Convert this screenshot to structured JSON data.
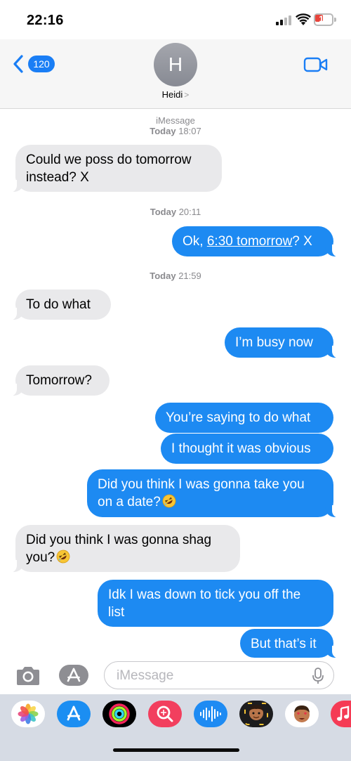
{
  "status_bar": {
    "time": "22:16",
    "battery_level": "10",
    "battery_color": "#e8453c"
  },
  "header": {
    "back_count": "120",
    "avatar_initial": "H",
    "contact_name": "Heidi",
    "contact_chevron": ">"
  },
  "conversation": {
    "service": "iMessage",
    "stamps": [
      {
        "day": "Today",
        "time": "18:07"
      },
      {
        "day": "Today",
        "time": "20:11"
      },
      {
        "day": "Today",
        "time": "21:59"
      }
    ],
    "messages": [
      {
        "direction": "received",
        "line1": "Could we poss do tomorrow",
        "line2": "instead? X"
      },
      {
        "direction": "sent",
        "prefix": "Ok, ",
        "link": "6:30 tomorrow",
        "suffix": "? X"
      },
      {
        "direction": "received",
        "text": "To do what"
      },
      {
        "direction": "sent",
        "text": "I’m busy now"
      },
      {
        "direction": "received",
        "text": "Tomorrow?"
      },
      {
        "direction": "sent",
        "text": "You’re saying to do what"
      },
      {
        "direction": "sent",
        "text": "I thought it was obvious"
      },
      {
        "direction": "sent",
        "line1": "Did you think I was gonna take you",
        "line2": "on a date?",
        "emoji": "rolling-on-floor-laughing"
      },
      {
        "direction": "received",
        "line1": "Did you think I was gonna shag",
        "line2": "you?",
        "emoji": "rolling-on-floor-laughing"
      },
      {
        "direction": "sent",
        "line1": "Idk I was down to tick you off the",
        "line2": "list"
      },
      {
        "direction": "sent",
        "text": "But that’s it"
      }
    ]
  },
  "composer": {
    "placeholder": "iMessage"
  },
  "app_drawer": {
    "apps": [
      "photos-app-icon",
      "app-store-icon",
      "activity-icon",
      "search-images-icon",
      "audio-message-icon",
      "memoji-icon",
      "memoji-stickers-icon",
      "music-icon"
    ]
  },
  "colors": {
    "accent": "#1a7ef5",
    "sent_bubble": "#1d8af2",
    "received_bubble": "#e9e9eb"
  }
}
